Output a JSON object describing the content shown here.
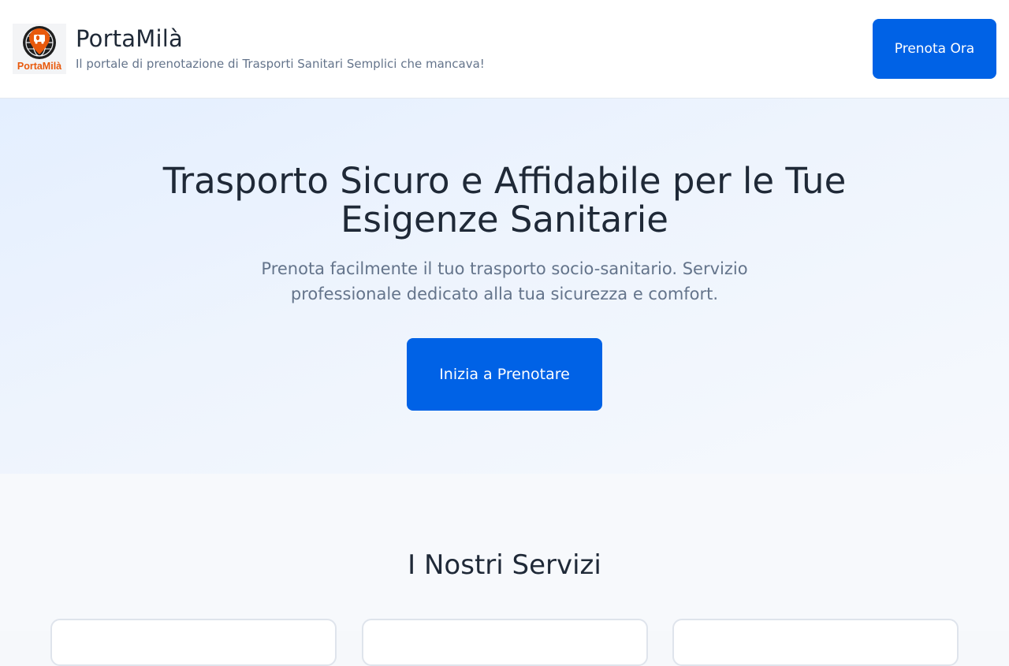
{
  "header": {
    "logo": {
      "alt_wordmark": "PortaMilà",
      "icon": "ambulance-pin-globe-icon",
      "colors": {
        "primary": "#e8590c",
        "dark": "#1f1f1f"
      }
    },
    "brand_name": "PortaMilà",
    "tagline": "Il portale di prenotazione di Trasporti Sanitari Semplici che mancava!",
    "cta_label": "Prenota Ora"
  },
  "hero": {
    "title": "Trasporto Sicuro e Affidabile per le Tue Esigenze Sanitarie",
    "subtitle": "Prenota facilmente il tuo trasporto socio-sanitario. Servizio professionale dedicato alla tua sicurezza e comfort.",
    "cta_label": "Inizia a Prenotare"
  },
  "services": {
    "title": "I Nostri Servizi",
    "cards": [
      {
        "title": ""
      },
      {
        "title": ""
      },
      {
        "title": ""
      }
    ]
  },
  "theme": {
    "accent": "#0062e6",
    "text_dark": "#1f2937",
    "text_muted": "#64748b",
    "hero_bg": "#e4efff"
  }
}
